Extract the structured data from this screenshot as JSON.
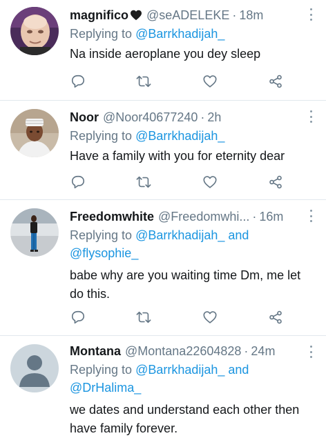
{
  "tweets": [
    {
      "name": "magnifico",
      "emoji": "black-heart-icon",
      "handle": "@seADELEKE",
      "separator": "·",
      "time": "18m",
      "replying_prefix": "Replying to ",
      "mentions": [
        "@Barrkhadijah_"
      ],
      "text": "Na inside aeroplane you dey sleep"
    },
    {
      "name": "Noor",
      "handle": "@Noor40677240",
      "separator": "·",
      "time": "2h",
      "replying_prefix": "Replying to ",
      "mentions": [
        "@Barrkhadijah_"
      ],
      "text": "Have a family with you for eternity dear"
    },
    {
      "name": "Freedomwhite",
      "handle": "@Freedomwhi...",
      "separator": "·",
      "time": "16m",
      "replying_prefix": "Replying to ",
      "mentions": [
        "@Barrkhadijah_",
        "@flysophie_"
      ],
      "and": " and",
      "text": "babe why are you waiting time Dm, me let do this."
    },
    {
      "name": "Montana",
      "handle": "@Montana22604828",
      "separator": "·",
      "time": "24m",
      "replying_prefix": "Replying to ",
      "mentions": [
        "@Barrkhadijah_",
        "@DrHalima_"
      ],
      "and": " and",
      "text": "we dates and understand each other then have family forever."
    }
  ],
  "icons": {
    "reply": "reply-icon",
    "retweet": "retweet-icon",
    "like": "like-icon",
    "share": "share-icon",
    "more": "more-icon"
  },
  "colors": {
    "link": "#1b95e0",
    "secondary_text": "#657786",
    "primary_text": "#14171a",
    "icon": "#657786",
    "divider": "#e1e8ed"
  }
}
